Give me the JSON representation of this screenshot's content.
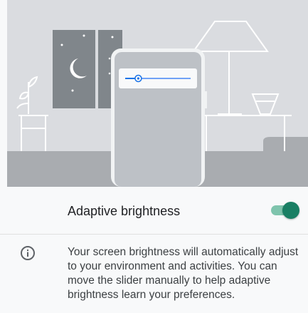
{
  "illustration": {
    "icon": "brightness-illustration",
    "slider_level": 0.2
  },
  "settings": {
    "adaptive_brightness_label": "Adaptive brightness",
    "adaptive_brightness_enabled": true,
    "accent_color": "#1a7f64"
  },
  "footer": {
    "info_icon": "info-icon",
    "description": "Your screen brightness will automatically adjust to your environment and activities. You can move the slider manually to help adaptive brightness learn your preferences."
  }
}
